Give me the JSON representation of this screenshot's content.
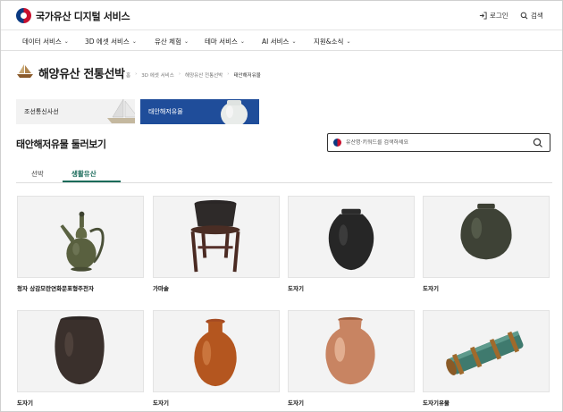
{
  "header": {
    "logo_text": "국가유산 디지털 서비스",
    "login_label": "로그인",
    "search_label": "검색"
  },
  "nav": [
    {
      "label": "데이터 서비스"
    },
    {
      "label": "3D 에셋 서비스"
    },
    {
      "label": "유산 체험"
    },
    {
      "label": "테마 서비스"
    },
    {
      "label": "AI 서비스"
    },
    {
      "label": "지원&소식"
    }
  ],
  "page": {
    "title": "해양유산 전통선박",
    "breadcrumb": [
      "홈",
      "3D 에셋 서비스",
      "해양유산 전통선박",
      "태안해저유물"
    ]
  },
  "categories": [
    {
      "label": "조선통신사선",
      "active": false
    },
    {
      "label": "태안해저유물",
      "active": true
    }
  ],
  "section": {
    "title": "태안해저유물 둘러보기",
    "search_placeholder": "유산명·키워드를 검색하세요"
  },
  "tabs": [
    {
      "label": "선박",
      "active": false
    },
    {
      "label": "생활유산",
      "active": true
    }
  ],
  "items": [
    {
      "caption": "청자 상감모란연화문표형주전자"
    },
    {
      "caption": "가마솥"
    },
    {
      "caption": "도자기"
    },
    {
      "caption": "도자기"
    },
    {
      "caption": "도자기"
    },
    {
      "caption": "도자기"
    },
    {
      "caption": "도자기"
    },
    {
      "caption": "도자기유물"
    }
  ],
  "colors": {
    "accent_green": "#1a6b5a",
    "category_active": "#1f4d9a"
  }
}
